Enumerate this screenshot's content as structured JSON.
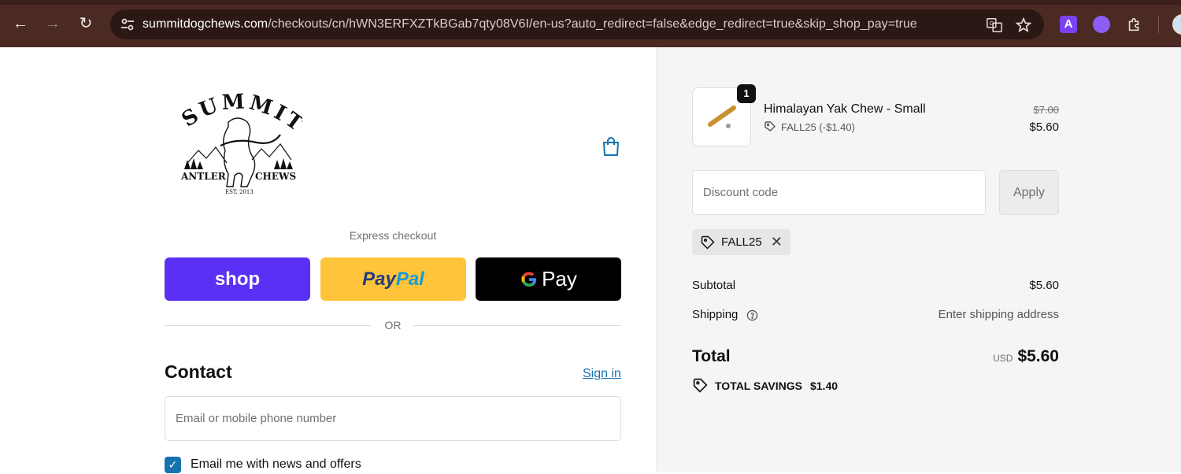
{
  "browser": {
    "url_host": "summitdogchews.com",
    "url_rest": "/checkouts/cn/hWN3ERFXZTkBGab7qty08V6I/en-us?auto_redirect=false&edge_redirect=true&skip_shop_pay=true",
    "icons": [
      "back-icon",
      "forward-icon",
      "reload-icon",
      "site-settings-icon",
      "translate-icon",
      "bookmark-star-icon",
      "extension-a-icon",
      "extension-circle-icon",
      "extensions-puzzle-icon",
      "profile-avatar"
    ],
    "extension_a_label": "A"
  },
  "store": {
    "logo_alt": "SUMMIT ANTLER CHEWS EST. 2013",
    "logo_top": "SUMMIT",
    "logo_left": "ANTLER",
    "logo_right": "CHEWS",
    "logo_est": "EST. 2013"
  },
  "express": {
    "label": "Express checkout",
    "shop_label": "shop",
    "paypal_label_1": "Pay",
    "paypal_label_2": "Pal",
    "gpay_label": "Pay",
    "or_label": "OR"
  },
  "contact": {
    "title": "Contact",
    "sign_in": "Sign in",
    "email_placeholder": "Email or mobile phone number",
    "email_value": "",
    "newsletter_label": "Email me with news and offers",
    "newsletter_checked": true
  },
  "order": {
    "quantity": "1",
    "product_name": "Himalayan Yak Chew - Small",
    "discount_applied": "FALL25 (-$1.40)",
    "original_price": "$7.00",
    "price": "$5.60",
    "discount_placeholder": "Discount code",
    "apply_label": "Apply",
    "chip_code": "FALL25",
    "subtotal_label": "Subtotal",
    "subtotal_value": "$5.60",
    "shipping_label": "Shipping",
    "shipping_value": "Enter shipping address",
    "total_label": "Total",
    "currency": "USD",
    "total_value": "$5.60",
    "savings_label": "TOTAL SAVINGS",
    "savings_value": "$1.40"
  },
  "colors": {
    "chrome_bg": "#4a2a23",
    "shop_purple": "#5a31f4",
    "paypal_yellow": "#ffc439",
    "link_blue": "#1773b0"
  }
}
